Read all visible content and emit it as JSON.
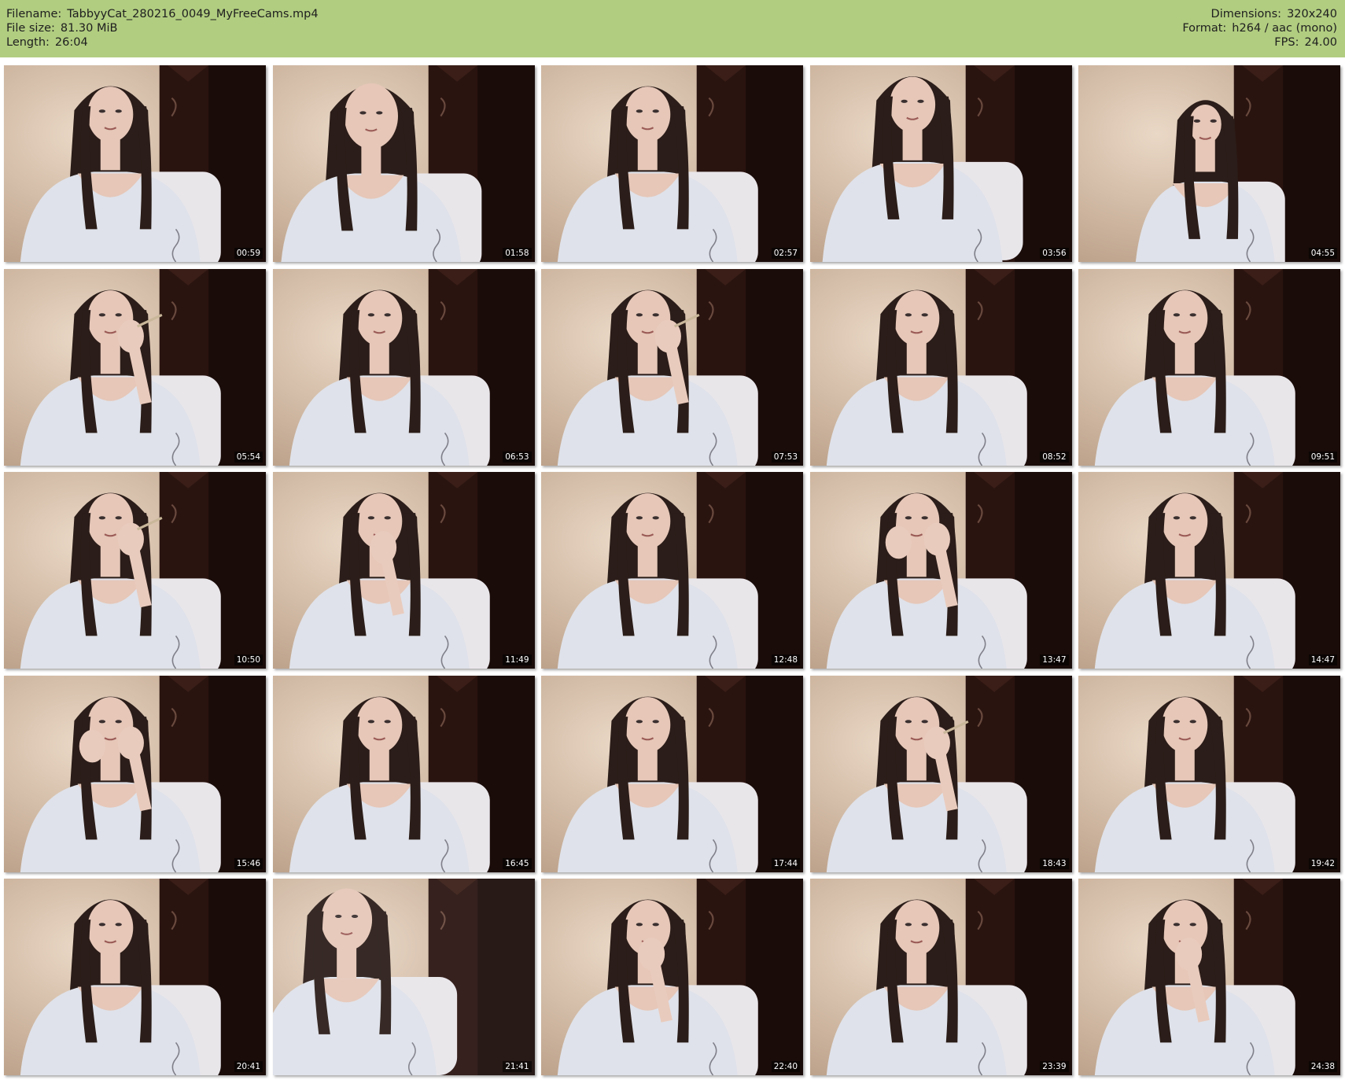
{
  "header": {
    "filename_label": "Filename:",
    "filename": "TabbyyCat_280216_0049_MyFreeCams.mp4",
    "filesize_label": "File size:",
    "filesize": "81.30 MiB",
    "length_label": "Length:",
    "length": "26:04",
    "dimensions_label": "Dimensions:",
    "dimensions": "320x240",
    "format_label": "Format:",
    "format": "h264 / aac (mono)",
    "fps_label": "FPS:",
    "fps": "24.00"
  },
  "colors": {
    "header_bg": "#b1cd80",
    "page_bg": "#ffffff",
    "wall": "#ead8c6",
    "door": "#2a1410",
    "hair": "#2b1d19",
    "skin": "#e6c7b8",
    "shirt": "#dfe2ea"
  },
  "thumbnails": [
    {
      "timestamp": "00:59",
      "pose": "center"
    },
    {
      "timestamp": "01:58",
      "pose": "close"
    },
    {
      "timestamp": "02:57",
      "pose": "center"
    },
    {
      "timestamp": "03:56",
      "pose": "tilt"
    },
    {
      "timestamp": "04:55",
      "pose": "far"
    },
    {
      "timestamp": "05:54",
      "pose": "hand"
    },
    {
      "timestamp": "06:53",
      "pose": "center"
    },
    {
      "timestamp": "07:53",
      "pose": "hand"
    },
    {
      "timestamp": "08:52",
      "pose": "center"
    },
    {
      "timestamp": "09:51",
      "pose": "center"
    },
    {
      "timestamp": "10:50",
      "pose": "hand"
    },
    {
      "timestamp": "11:49",
      "pose": "chin"
    },
    {
      "timestamp": "12:48",
      "pose": "center"
    },
    {
      "timestamp": "13:47",
      "pose": "hands-face"
    },
    {
      "timestamp": "14:47",
      "pose": "center"
    },
    {
      "timestamp": "15:46",
      "pose": "hands-face"
    },
    {
      "timestamp": "16:45",
      "pose": "center"
    },
    {
      "timestamp": "17:44",
      "pose": "center"
    },
    {
      "timestamp": "18:43",
      "pose": "hand"
    },
    {
      "timestamp": "19:42",
      "pose": "center"
    },
    {
      "timestamp": "20:41",
      "pose": "center"
    },
    {
      "timestamp": "21:41",
      "pose": "blur"
    },
    {
      "timestamp": "22:40",
      "pose": "chin"
    },
    {
      "timestamp": "23:39",
      "pose": "center"
    },
    {
      "timestamp": "24:38",
      "pose": "chin"
    }
  ]
}
